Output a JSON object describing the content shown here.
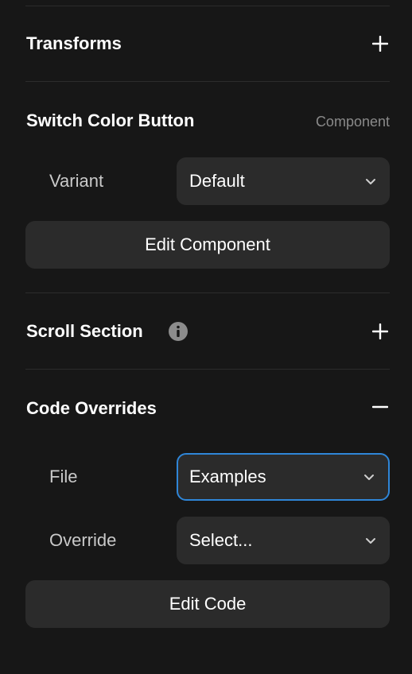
{
  "sections": {
    "transforms": {
      "title": "Transforms",
      "action_icon": "plus-icon"
    },
    "component": {
      "title": "Switch Color Button",
      "meta": "Component",
      "variant": {
        "label": "Variant",
        "value": "Default",
        "icon": "chevron-down-icon"
      },
      "edit_button": "Edit Component"
    },
    "scroll": {
      "title": "Scroll Section",
      "info_icon": "info-icon",
      "action_icon": "plus-icon"
    },
    "code_overrides": {
      "title": "Code Overrides",
      "action_icon": "minus-icon",
      "file": {
        "label": "File",
        "value": "Examples",
        "focused": true,
        "icon": "chevron-down-icon"
      },
      "override": {
        "label": "Override",
        "value": "Select...",
        "icon": "chevron-down-icon"
      },
      "edit_button": "Edit Code"
    }
  },
  "colors": {
    "background": "#171717",
    "control": "#2b2b2b",
    "focus_ring": "#2f86d8",
    "muted_text": "#8a8a8a"
  }
}
